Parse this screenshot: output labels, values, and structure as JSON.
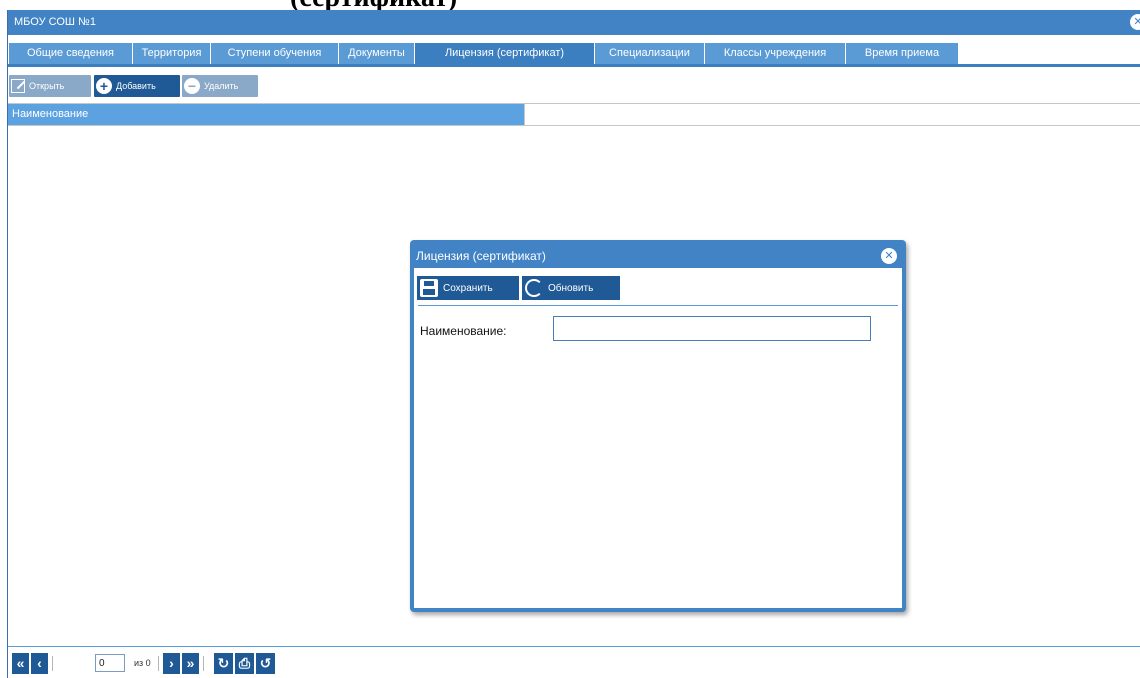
{
  "top_heading": "(сертификат)",
  "window": {
    "title": "МБОУ СОШ №1",
    "close_glyph": "✕"
  },
  "tabs": [
    {
      "label": "Общие сведения",
      "active": false
    },
    {
      "label": "Территория",
      "active": false
    },
    {
      "label": "Ступени обучения",
      "active": false
    },
    {
      "label": "Документы",
      "active": false
    },
    {
      "label": "Лицензия (сертификат)",
      "active": true
    },
    {
      "label": "Специализации",
      "active": false
    },
    {
      "label": "Классы учреждения",
      "active": false
    },
    {
      "label": "Время приема",
      "active": false
    }
  ],
  "toolbar": {
    "open_label": "Открыть",
    "add_label": "Добавить",
    "delete_label": "Удалить",
    "add_glyph": "+",
    "delete_glyph": "−"
  },
  "grid": {
    "columns": [
      "Наименование"
    ],
    "rows": []
  },
  "pager": {
    "first_glyph": "«",
    "prev_glyph": "‹",
    "next_glyph": "›",
    "last_glyph": "»",
    "reload_glyph": "↻",
    "print_glyph": "⎙",
    "settings_glyph": "↺",
    "page_value": "0",
    "of_label": "из 0"
  },
  "dialog": {
    "title": "Лицензия (сертификат)",
    "close_glyph": "✕",
    "save_label": "Сохранить",
    "refresh_label": "Обновить",
    "name_label": "Наименование:",
    "name_value": ""
  },
  "colors": {
    "titlebar": "#4183c4",
    "tab": "#5b9bd5",
    "tab_active": "#3b7fc0",
    "button": "#1f5a96",
    "button_disabled": "#8aa9c8",
    "grid_header": "#5da2e0"
  }
}
